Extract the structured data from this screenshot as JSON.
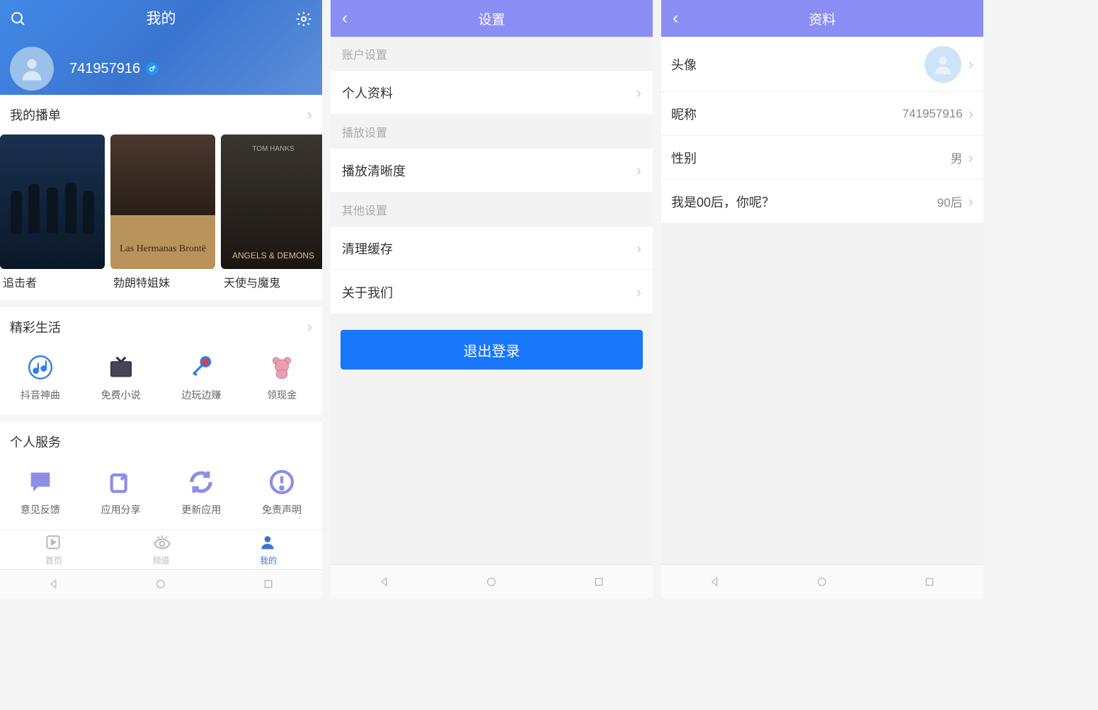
{
  "screen1": {
    "title": "我的",
    "userId": "741957916",
    "playlist": {
      "title": "我的播单",
      "movies": [
        {
          "name": "追击者",
          "posterTitle": ""
        },
        {
          "name": "勃朗特姐妹",
          "posterTitle": "Las Hermanas Brontë"
        },
        {
          "name": "天使与魔鬼",
          "posterTitle": "ANGELS & DEMONS",
          "posterSub": "TOM HANKS"
        }
      ]
    },
    "wonderful": {
      "title": "精彩生活",
      "items": [
        "抖音神曲",
        "免费小说",
        "边玩边赚",
        "领现金"
      ]
    },
    "services": {
      "title": "个人服务",
      "items": [
        "意见反馈",
        "应用分享",
        "更新应用",
        "免责声明"
      ]
    },
    "tabs": [
      "首页",
      "频道",
      "我的"
    ]
  },
  "screen2": {
    "title": "设置",
    "groups": {
      "account": "账户设置",
      "playback": "播放设置",
      "other": "其他设置"
    },
    "rows": {
      "profile": "个人资料",
      "quality": "播放清晰度",
      "cache": "清理缓存",
      "about": "关于我们"
    },
    "logout": "退出登录"
  },
  "screen3": {
    "title": "资料",
    "rows": {
      "avatar": "头像",
      "nickname": {
        "label": "昵称",
        "value": "741957916"
      },
      "gender": {
        "label": "性别",
        "value": "男"
      },
      "generation": {
        "label": "我是00后，你呢？",
        "value": "90后"
      }
    }
  }
}
